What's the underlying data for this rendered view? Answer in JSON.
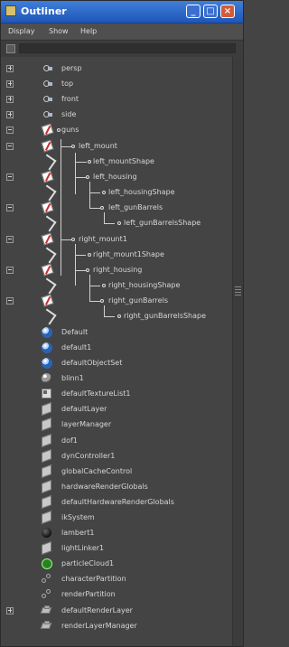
{
  "window": {
    "title": "Outliner",
    "buttons": [
      "_",
      "□",
      "×"
    ]
  },
  "menubar": [
    "Display",
    "Show",
    "Help"
  ],
  "rows": [
    {
      "label": "persp",
      "icon": "camera-icon",
      "expander": "plus"
    },
    {
      "label": "top",
      "icon": "camera-icon",
      "expander": "plus"
    },
    {
      "label": "front",
      "icon": "camera-icon",
      "expander": "plus"
    },
    {
      "label": "side",
      "icon": "camera-icon",
      "expander": "plus"
    },
    {
      "label": "guns",
      "icon": "transform-icon",
      "expander": "minus"
    },
    {
      "label": "left_mount",
      "icon": "transform-icon",
      "expander": "minus"
    },
    {
      "label": "left_mountShape",
      "icon": "shape-icon",
      "expander": ""
    },
    {
      "label": "left_housing",
      "icon": "transform-icon",
      "expander": "minus"
    },
    {
      "label": "left_housingShape",
      "icon": "shape-icon",
      "expander": ""
    },
    {
      "label": "left_gunBarrels",
      "icon": "transform-icon",
      "expander": "minus"
    },
    {
      "label": "left_gunBarrelsShape",
      "icon": "shape-icon",
      "expander": ""
    },
    {
      "label": "right_mount1",
      "icon": "transform-icon",
      "expander": "minus"
    },
    {
      "label": "right_mount1Shape",
      "icon": "shape-icon",
      "expander": ""
    },
    {
      "label": "right_housing",
      "icon": "transform-icon",
      "expander": "minus"
    },
    {
      "label": "right_housingShape",
      "icon": "shape-icon",
      "expander": ""
    },
    {
      "label": "right_gunBarrels",
      "icon": "transform-icon",
      "expander": "minus"
    },
    {
      "label": "right_gunBarrelsShape",
      "icon": "shape-icon",
      "expander": ""
    },
    {
      "label": "Default",
      "icon": "blue-sphere-icon",
      "expander": ""
    },
    {
      "label": "default1",
      "icon": "blue-sphere-icon",
      "expander": ""
    },
    {
      "label": "defaultObjectSet",
      "icon": "blue-sphere-icon",
      "expander": ""
    },
    {
      "label": "blinn1",
      "icon": "sphere-icon",
      "expander": ""
    },
    {
      "label": "defaultTextureList1",
      "icon": "texture-icon",
      "expander": ""
    },
    {
      "label": "defaultLayer",
      "icon": "cube-icon",
      "expander": ""
    },
    {
      "label": "layerManager",
      "icon": "cube-icon",
      "expander": ""
    },
    {
      "label": "dof1",
      "icon": "cube-icon",
      "expander": ""
    },
    {
      "label": "dynController1",
      "icon": "cube-icon",
      "expander": ""
    },
    {
      "label": "globalCacheControl",
      "icon": "cube-icon",
      "expander": ""
    },
    {
      "label": "hardwareRenderGlobals",
      "icon": "cube-icon",
      "expander": ""
    },
    {
      "label": "defaultHardwareRenderGlobals",
      "icon": "cube-icon",
      "expander": ""
    },
    {
      "label": "ikSystem",
      "icon": "cube-icon",
      "expander": ""
    },
    {
      "label": "lambert1",
      "icon": "grey-ball-icon",
      "expander": ""
    },
    {
      "label": "lightLinker1",
      "icon": "cube-icon",
      "expander": ""
    },
    {
      "label": "particleCloud1",
      "icon": "green-ball-icon",
      "expander": ""
    },
    {
      "label": "characterPartition",
      "icon": "partition-icon",
      "expander": ""
    },
    {
      "label": "renderPartition",
      "icon": "partition-icon",
      "expander": ""
    },
    {
      "label": "defaultRenderLayer",
      "icon": "render-layer-icon",
      "expander": "plus"
    },
    {
      "label": "renderLayerManager",
      "icon": "render-layer-icon",
      "expander": ""
    }
  ]
}
